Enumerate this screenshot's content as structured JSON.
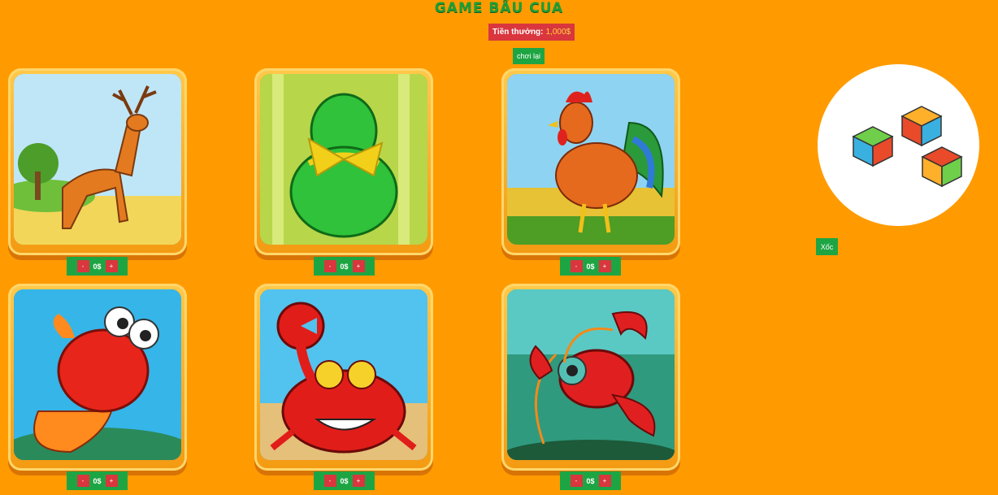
{
  "title": "GAME BẦU CUA",
  "prize": {
    "label": "Tiền thưởng:",
    "amount": "1,000$"
  },
  "replay_label": "chơi lại",
  "shake_label": "Xốc",
  "bet_controls": {
    "minus": "-",
    "plus": "+"
  },
  "cards": [
    {
      "name": "deer",
      "bet": "0$"
    },
    {
      "name": "gourd",
      "bet": "0$"
    },
    {
      "name": "rooster",
      "bet": "0$"
    },
    {
      "name": "fish",
      "bet": "0$"
    },
    {
      "name": "crab",
      "bet": "0$"
    },
    {
      "name": "shrimp",
      "bet": "0$"
    }
  ],
  "colors": {
    "background": "#ff9b00",
    "accent_green": "#1ea543",
    "accent_red": "#d9363e",
    "prize_amount": "#ffd23f"
  }
}
